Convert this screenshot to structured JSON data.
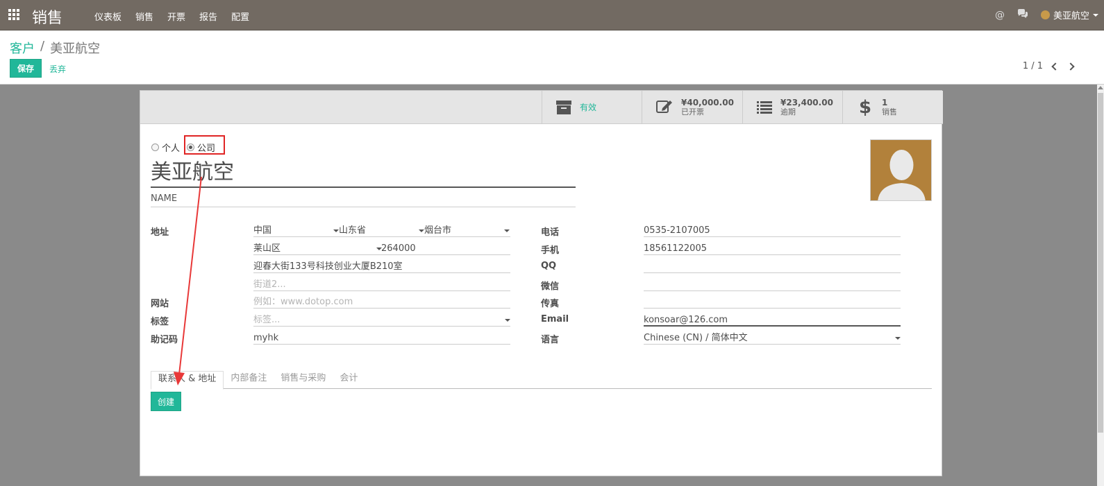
{
  "navbar": {
    "brand": "销售",
    "menu": [
      "仪表板",
      "销售",
      "开票",
      "报告",
      "配置"
    ],
    "user_name": "美亚航空",
    "at_icon": "@"
  },
  "control_panel": {
    "breadcrumb_parent": "客户",
    "breadcrumb_sep": "/",
    "breadcrumb_current": "美亚航空",
    "save_label": "保存",
    "discard_label": "丢弃",
    "pager": "1 / 1"
  },
  "button_box": {
    "active_label": "有效",
    "invoiced_value": "¥40,000.00",
    "invoiced_label": "已开票",
    "overdue_value": "¥23,400.00",
    "overdue_label": "逾期",
    "sales_value": "1",
    "sales_label": "销售",
    "dollar_icon": "$"
  },
  "form": {
    "type_person": "个人",
    "type_company": "公司",
    "name": "美亚航空",
    "subname": "NAME",
    "labels": {
      "address": "地址",
      "website": "网站",
      "tags": "标签",
      "ref": "助记码",
      "phone": "电话",
      "mobile": "手机",
      "qq": "QQ",
      "wechat": "微信",
      "fax": "传真",
      "email": "Email",
      "lang": "语言"
    },
    "address": {
      "country": "中国",
      "state": "山东省",
      "city": "烟台市",
      "district": "莱山区",
      "zip": "264000",
      "street": "迎春大街133号科技创业大厦B210室",
      "street2_placeholder": "街道2..."
    },
    "website_placeholder": "例如：www.dotop.com",
    "tags_placeholder": "标签...",
    "ref": "myhk",
    "phone": "0535-2107005",
    "mobile": "18561122005",
    "qq": "",
    "wechat": "",
    "fax": "",
    "email": "konsoar@126.com",
    "lang": "Chinese (CN) / 简体中文"
  },
  "tabs": [
    "联系人 & 地址",
    "内部备注",
    "销售与采购",
    "会计"
  ],
  "create_label": "创建",
  "colors": {
    "navbar": "#726a62",
    "accent": "#21b799",
    "highlight": "#e02424",
    "avatar_bg": "#b2813b"
  }
}
